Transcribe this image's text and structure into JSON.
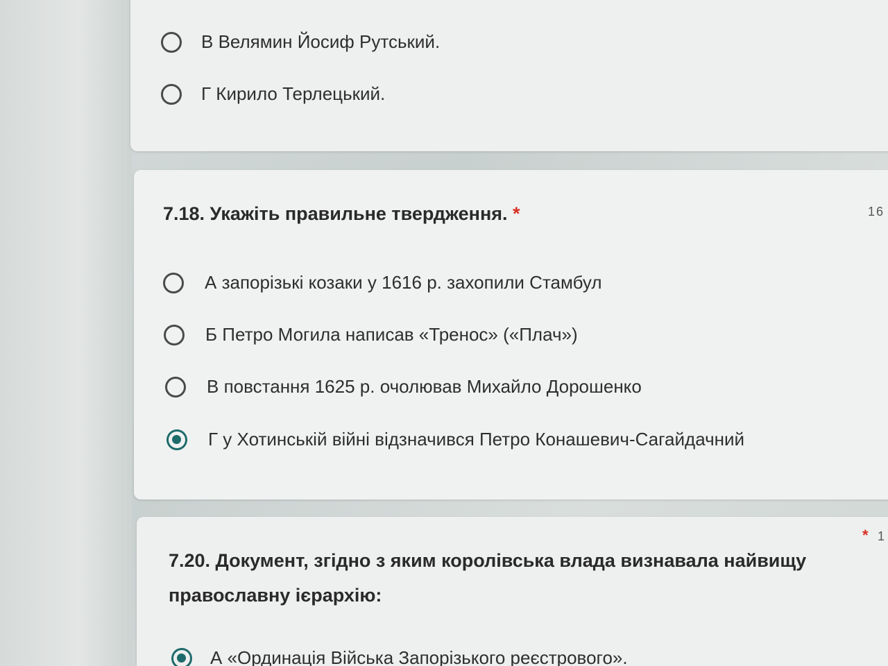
{
  "prev_question": {
    "options": [
      {
        "label": "В Велямин Йосиф Рутський.",
        "checked": false
      },
      {
        "label": "Г Кирило Терлецький.",
        "checked": false
      }
    ]
  },
  "question_718": {
    "title": "7.18. Укажіть правильне твердження.",
    "required_mark": "*",
    "points": "16",
    "options": [
      {
        "label": "А запорізькі козаки у 1616 р. захопили Стамбул",
        "checked": false
      },
      {
        "label": "Б Петро Могила написав «Тренос» («Плач»)",
        "checked": false
      },
      {
        "label": "В повстання 1625 р. очолював Михайло Дорошенко",
        "checked": false
      },
      {
        "label": "Г у Хотинській війні відзначився Петро Конашевич-Сагайдачний",
        "checked": true
      }
    ]
  },
  "question_720": {
    "title_line1": "7.20. Документ, згідно з яким королівська влада визнавала найвищу",
    "title_line2": "православну ієрархію:",
    "required_mark": "*",
    "points": "1",
    "options": [
      {
        "label": "А «Ординація Війська Запорізького реєстрового».",
        "checked": true
      }
    ]
  },
  "colors": {
    "accent": "#1d6b6a",
    "required": "#d93025"
  }
}
